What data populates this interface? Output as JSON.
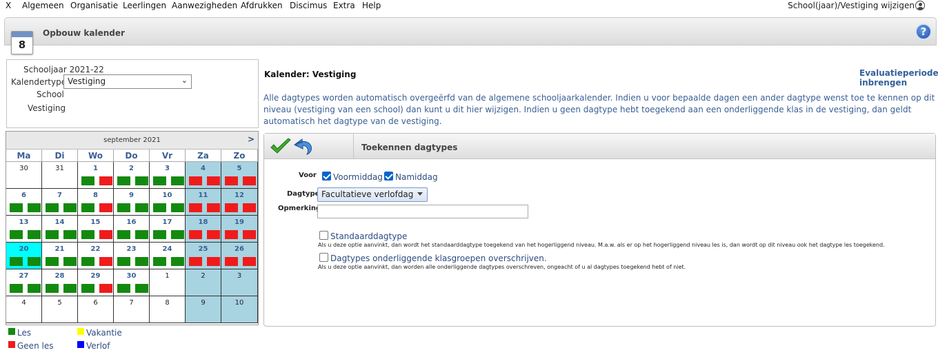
{
  "menu": {
    "items": [
      "X",
      "Algemeen",
      "Organisatie",
      "Leerlingen",
      "Aanwezigheden",
      "Afdrukken",
      "Discimus",
      "Extra",
      "Help"
    ],
    "right_label": "School(jaar)/Vestiging wijzigen"
  },
  "titlebar": {
    "title": "Opbouw kalender",
    "calendar_icon_number": "8",
    "help_label": "?"
  },
  "info": {
    "schooljaar_label": "Schooljaar 2021-22",
    "kalendertype_label": "Kalendertype",
    "kalendertype_value": "Vestiging",
    "school_label": "School",
    "vestiging_label": "Vestiging"
  },
  "calendar": {
    "month": "september 2021",
    "next_label": ">",
    "weekdays": [
      "Ma",
      "Di",
      "Wo",
      "Do",
      "Vr",
      "Za",
      "Zo"
    ],
    "weeks": [
      [
        {
          "d": "30",
          "cur": false,
          "bars": []
        },
        {
          "d": "31",
          "cur": false,
          "bars": []
        },
        {
          "d": "1",
          "cur": true,
          "bars": [
            "g",
            "r"
          ]
        },
        {
          "d": "2",
          "cur": true,
          "bars": [
            "g",
            "g"
          ]
        },
        {
          "d": "3",
          "cur": true,
          "bars": [
            "g",
            "g"
          ]
        },
        {
          "d": "4",
          "cur": true,
          "we": true,
          "bars": [
            "r",
            "r"
          ]
        },
        {
          "d": "5",
          "cur": true,
          "we": true,
          "bars": [
            "r",
            "r"
          ]
        }
      ],
      [
        {
          "d": "6",
          "cur": true,
          "bars": [
            "g",
            "g"
          ]
        },
        {
          "d": "7",
          "cur": true,
          "bars": [
            "g",
            "g"
          ]
        },
        {
          "d": "8",
          "cur": true,
          "bars": [
            "g",
            "r"
          ]
        },
        {
          "d": "9",
          "cur": true,
          "bars": [
            "g",
            "g"
          ]
        },
        {
          "d": "10",
          "cur": true,
          "bars": [
            "g",
            "g"
          ]
        },
        {
          "d": "11",
          "cur": true,
          "we": true,
          "bars": [
            "r",
            "r"
          ]
        },
        {
          "d": "12",
          "cur": true,
          "we": true,
          "bars": [
            "r",
            "r"
          ]
        }
      ],
      [
        {
          "d": "13",
          "cur": true,
          "bars": [
            "g",
            "g"
          ]
        },
        {
          "d": "14",
          "cur": true,
          "bars": [
            "g",
            "g"
          ]
        },
        {
          "d": "15",
          "cur": true,
          "bars": [
            "g",
            "r"
          ]
        },
        {
          "d": "16",
          "cur": true,
          "bars": [
            "g",
            "g"
          ]
        },
        {
          "d": "17",
          "cur": true,
          "bars": [
            "g",
            "g"
          ]
        },
        {
          "d": "18",
          "cur": true,
          "we": true,
          "bars": [
            "r",
            "r"
          ]
        },
        {
          "d": "19",
          "cur": true,
          "we": true,
          "bars": [
            "r",
            "r"
          ]
        }
      ],
      [
        {
          "d": "20",
          "cur": true,
          "today": true,
          "bars": [
            "g",
            "g"
          ]
        },
        {
          "d": "21",
          "cur": true,
          "bars": [
            "g",
            "g"
          ]
        },
        {
          "d": "22",
          "cur": true,
          "bars": [
            "g",
            "r"
          ]
        },
        {
          "d": "23",
          "cur": true,
          "bars": [
            "g",
            "g"
          ]
        },
        {
          "d": "24",
          "cur": true,
          "bars": [
            "g",
            "g"
          ]
        },
        {
          "d": "25",
          "cur": true,
          "we": true,
          "bars": [
            "r",
            "r"
          ]
        },
        {
          "d": "26",
          "cur": true,
          "we": true,
          "bars": [
            "r",
            "r"
          ]
        }
      ],
      [
        {
          "d": "27",
          "cur": true,
          "bars": [
            "g",
            "g"
          ]
        },
        {
          "d": "28",
          "cur": true,
          "bars": [
            "g",
            "g"
          ]
        },
        {
          "d": "29",
          "cur": true,
          "bars": [
            "g",
            "r"
          ]
        },
        {
          "d": "30",
          "cur": true,
          "bars": [
            "g",
            "g"
          ]
        },
        {
          "d": "1",
          "cur": false,
          "bars": []
        },
        {
          "d": "2",
          "cur": false,
          "we": true,
          "bars": []
        },
        {
          "d": "3",
          "cur": false,
          "we": true,
          "bars": []
        }
      ],
      [
        {
          "d": "4",
          "cur": false,
          "bars": []
        },
        {
          "d": "5",
          "cur": false,
          "bars": []
        },
        {
          "d": "6",
          "cur": false,
          "bars": []
        },
        {
          "d": "7",
          "cur": false,
          "bars": []
        },
        {
          "d": "8",
          "cur": false,
          "bars": []
        },
        {
          "d": "9",
          "cur": false,
          "we": true,
          "bars": []
        },
        {
          "d": "10",
          "cur": false,
          "we": true,
          "bars": []
        }
      ]
    ]
  },
  "legend": {
    "les": "Les",
    "geen_les": "Geen les",
    "vakantie": "Vakantie",
    "verlof": "Verlof",
    "colors": {
      "les": "#138a0f",
      "geen_les": "#ef1c1c",
      "vakantie": "#ffff00",
      "verlof": "#0000ff"
    }
  },
  "main": {
    "title": "Kalender: Vestiging",
    "link": "Evaluatieperiodes inbrengen",
    "description": "Alle dagtypes worden automatisch overgeërfd van de algemene schooljaarkalender. Indien u voor bepaalde dagen een ander dagtype wenst toe te kennen op dit niveau (vestiging van een school) dan kunt u dit hier wijzigen. Indien u geen dagtype hebt toegekend aan een onderliggende klas in de vestiging, dan geldt automatisch het dagtype van de vestiging."
  },
  "panel": {
    "title": "Toekennen dagtypes",
    "voor_label": "Voor",
    "voormiddag": "Voormiddag",
    "namiddag": "Namiddag",
    "dagtype_label": "Dagtype",
    "dagtype_value": "Facultatieve verlofdag",
    "opmerking_label": "Opmerking",
    "opmerking_value": "",
    "standaard_label": "Standaarddagtype",
    "standaard_help": "Als u deze optie aanvinkt, dan wordt het standaarddagtype toegekend van het hogerliggend niveau. M.a.w. als er op het hogerliggend niveau les is, dan wordt op dit niveau ook het dagtype les toegekend.",
    "overschrijven_label": "Dagtypes onderliggende klasgroepen overschrijven.",
    "overschrijven_help": "Als u deze optie aanvinkt, dan worden alle onderliggende dagtypes overschreven, ongeacht of u al dagtypes toegekend hebt of niet."
  }
}
